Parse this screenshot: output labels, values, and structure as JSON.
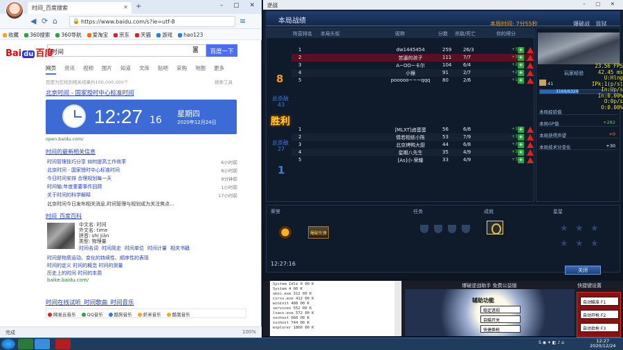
{
  "browser": {
    "tab_title": "时间_百度搜索",
    "url": "https://www.baidu.com/s?ie=utf-8",
    "bookmarks": [
      {
        "label": "收藏",
        "color": "#f5a623"
      },
      {
        "label": "360搜索",
        "color": "#2aa545"
      },
      {
        "label": "360导航",
        "color": "#2aa545"
      },
      {
        "label": "爱淘宝",
        "color": "#ff6a00"
      },
      {
        "label": "京东",
        "color": "#d9232d"
      },
      {
        "label": "天猫",
        "color": "#d9232d"
      },
      {
        "label": "游戏",
        "color": "#2a7de1"
      },
      {
        "label": "hao123",
        "color": "#2a7de1"
      }
    ],
    "search_query": "时间",
    "search_button": "百度一下",
    "tabs": [
      "网页",
      "资讯",
      "视频",
      "图片",
      "知道",
      "文库",
      "贴吧",
      "采购",
      "地图",
      "更多"
    ],
    "result_count": "百度为您找到相关结果约100,000,000个",
    "search_tools": "搜索工具",
    "r1_title": "北京时间 - 国家授时中心标准时间",
    "clock": {
      "time": "12:27",
      "seconds": "16",
      "weekday": "星期四",
      "date": "2020年12月24日"
    },
    "r1_url": "open.baidu.com/",
    "news_title": "时间的最新相关信息",
    "news_items": [
      {
        "text": "时间管理技巧分享 如何提高工作效率",
        "time": "6小时前"
      },
      {
        "text": "北京时间 - 国家授时中心标准时间",
        "time": "8小时前"
      },
      {
        "text": "今日时间安排 合理规划每一天",
        "time": "9分钟前"
      },
      {
        "text": "时间轴:年度重要事件回顾",
        "time": "1小时前"
      },
      {
        "text": "关于时间的科学解释",
        "time": "17小时前"
      }
    ],
    "news_snippet": "北京时间今日发布相关消息,时间管理与规划成为关注焦点...",
    "encyclopedia_title": "时间_百度百科",
    "meta": [
      "中文名: 时间",
      "外文名: time",
      "拼音: shí jiān",
      "类型: 物理量"
    ],
    "meta_links": [
      "时间名词",
      "时间简史",
      "时间单位",
      "时间计量",
      "相关书籍"
    ],
    "baike_rows": [
      "时间是物质运动、变化的持续性、顺序性的表现",
      "时间的定义 时间的概念 时间的测量",
      "历史上的时间 时间的本质",
      "baike.baidu.com/"
    ],
    "music_title": "时间在线试听_时间歌曲_时间音乐",
    "music_tabs": [
      {
        "label": "网易云音乐",
        "color": "#d23"
      },
      {
        "label": "QQ音乐",
        "color": "#2aa545"
      },
      {
        "label": "酷狗音乐",
        "color": "#2a7de1"
      },
      {
        "label": "虾米音乐",
        "color": "#f5a623"
      },
      {
        "label": "酷我音乐",
        "color": "#f5a623"
      }
    ],
    "status_text": "完成",
    "zoom": "100%"
  },
  "game": {
    "window_title": "逆战",
    "panel_title": "本局战绩",
    "game_time": "本局时间: 7分55秒",
    "mode": [
      "爆破战",
      "监狱"
    ],
    "columns": [
      "阵营排名",
      "本局头衔",
      "昵称",
      "分数",
      "杀敌/死亡",
      "你的得分"
    ],
    "team1": {
      "rank": "8",
      "kills_label": "总杀敌",
      "kills": "43",
      "players": [
        {
          "rank": "1",
          "name": "dw1445454",
          "score": "259",
          "kd": "26/3",
          "pts": "+35"
        },
        {
          "rank": "2",
          "name": "苦逼的孩子",
          "score": "111",
          "kd": "7/7",
          "pts": "+35"
        },
        {
          "rank": "3",
          "name": "A~OO~卡尔",
          "score": "104",
          "kd": "6/4",
          "pts": "+27"
        },
        {
          "rank": "4",
          "name": "小猴",
          "score": "91",
          "kd": "2/7",
          "pts": "+27"
        },
        {
          "rank": "5",
          "name": "pooooo~~~qqq",
          "score": "80",
          "kd": "2/6",
          "pts": "+1"
        }
      ]
    },
    "result": "胜利",
    "team2": {
      "rank": "1",
      "kills_label": "总杀敌",
      "kills": "27",
      "players": [
        {
          "rank": "1",
          "name": "[MLXT]卤蛋蛋",
          "score": "56",
          "kd": "6/8",
          "pts": "+3"
        },
        {
          "rank": "2",
          "name": "情若相依小陈",
          "score": "53",
          "kd": "7/9",
          "pts": "+3"
        },
        {
          "rank": "3",
          "name": "北京烤鸭大厨",
          "score": "44",
          "kd": "6/8",
          "pts": "+3"
        },
        {
          "rank": "4",
          "name": "星期八先生",
          "score": "35",
          "kd": "4/9",
          "pts": "+3"
        },
        {
          "rank": "5",
          "name": "[As]小·荣耀",
          "score": "33",
          "kd": "4/9",
          "pts": "+3"
        }
      ]
    },
    "side": {
      "rank_label": "玩家经验",
      "player_level": "41",
      "xp_text": "3169/6329",
      "xp_fraction": 0.5,
      "stats": [
        {
          "label": "本局经验值",
          "value": ""
        },
        {
          "label": "本局GP值",
          "value": "+282"
        },
        {
          "label": "本局获得声望",
          "value": "+0"
        },
        {
          "label": "本局技术分变化",
          "value": "+30"
        }
      ]
    },
    "net_overlay": [
      "23.56 FPS",
      "42.45 ms",
      "U:Hlng",
      "IPk:1(p/s)",
      "In:Up/s",
      "In:0.00%",
      "O:0p/s",
      "O:0.00%"
    ],
    "bottom": {
      "headers": [
        "荣誉",
        "任务",
        "成就",
        "星星"
      ],
      "medal2": "爆破先锋",
      "time": "12:27:16",
      "close": "关闭"
    }
  },
  "tool": {
    "list_rows": [
      "System Idle  0   00 K",
      "System       4   00 K",
      "smss.exe   312   00 K",
      "csrss.exe  412   00 K",
      "wininit    488   00 K",
      "services   552   00 K",
      "lsass.exe  572   00 K",
      "svchost    660   00 K",
      "svchost    744   00 K",
      "explorer  1860   00 K"
    ],
    "title": "爆破逆战助手  免费公益版",
    "func_label": "辅助功能",
    "buttons": [
      "稳定透视",
      "自瞄开关",
      "快捷换枪"
    ],
    "side_title": "快捷键设置",
    "side_buttons": [
      "自动瞄准 F1",
      "自动开枪 F2",
      "自动拾枪 F3"
    ]
  },
  "taskbar": {
    "time": "12:27",
    "date": "2020/12/24"
  }
}
